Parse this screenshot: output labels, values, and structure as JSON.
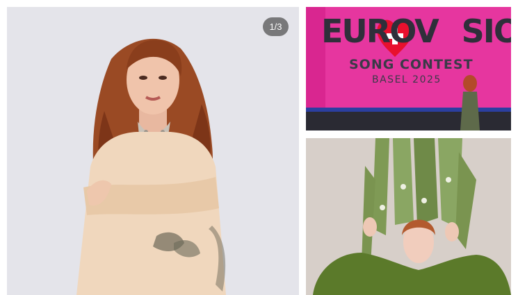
{
  "gallery": {
    "counter": "1/3",
    "colors": {
      "background": "#ffffff",
      "counter_bg": "#5a5a5a",
      "eurovision_pink": "#e72d9a",
      "heart_red": "#e8102e"
    },
    "photos": [
      {
        "name": "portrait-photo"
      },
      {
        "name": "eurovision-photo",
        "logo_word_left": "EUROV",
        "logo_word_right": "SION",
        "logo_subtitle": "SONG CONTEST",
        "logo_city": "BASEL 2025"
      },
      {
        "name": "nature-photo"
      }
    ]
  }
}
